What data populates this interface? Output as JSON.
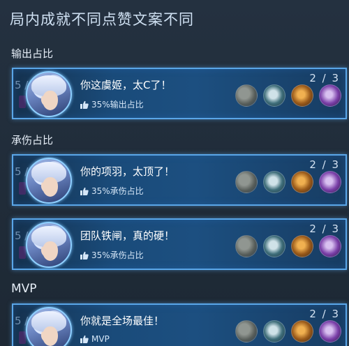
{
  "header": {
    "title": "局内成就不同点赞文案不同"
  },
  "sections": [
    {
      "label": "输出占比",
      "card": {
        "ghost_number": "5 /",
        "message": "你这虞姬，太C了！",
        "stat": "35%输出占比",
        "score": "2 / 3"
      }
    },
    {
      "label": "承伤占比",
      "cards": [
        {
          "ghost_number": "5 /",
          "message": "你的项羽，太顶了！",
          "stat": "35%承伤占比",
          "score": "2 / 3"
        },
        {
          "ghost_number": "5 /",
          "message": "团队铁闸，真的硬！",
          "stat": "35%承伤占比",
          "score": "2 / 3"
        }
      ]
    },
    {
      "label": "MVP",
      "card": {
        "ghost_number": "5 /",
        "message": "你就是全场最佳！",
        "stat": "MVP",
        "score": "2 / 3"
      }
    }
  ],
  "icons": {
    "thumb": "thumbs-up-icon",
    "items": [
      "boots-item-icon",
      "shield-item-icon",
      "fire-item-icon",
      "magic-item-icon"
    ]
  },
  "colors": {
    "accent_border": "#5aa6e8",
    "card_bg": "#1a4b7a",
    "page_bg": "#1f2a36"
  }
}
